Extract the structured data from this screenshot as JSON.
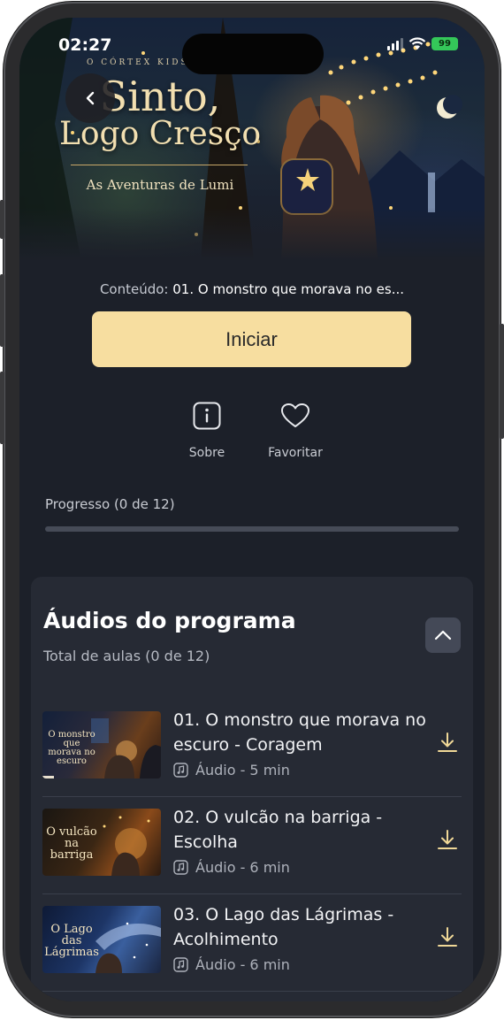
{
  "status_bar": {
    "time": "02:27",
    "battery": "99"
  },
  "hero": {
    "brand": "O CÓRTEX KIDS",
    "title_line1": "Sinto,",
    "title_line2": "Logo Cresço",
    "subtitle": "As Aventuras de Lumi"
  },
  "content": {
    "label": "Conteúdo:",
    "value": "01. O monstro que morava no es..."
  },
  "start_label": "Iniciar",
  "actions": {
    "about": "Sobre",
    "favorite": "Favoritar"
  },
  "progress": {
    "label": "Progresso (0 de 12)",
    "fraction": 0
  },
  "program": {
    "title": "Áudios do programa",
    "subtitle": "Total de aulas (0 de 12)",
    "lessons": [
      {
        "title": "01. O monstro que morava no escuro - Coragem",
        "meta": "Áudio - 5 min",
        "thumb_lines": [
          "O monstro que",
          "morava no escuro"
        ],
        "thumb_progress": 0.1
      },
      {
        "title": "02. O vulcão na barriga - Escolha",
        "meta": "Áudio - 6 min",
        "thumb_lines": [
          "O vulcão",
          "na barriga"
        ],
        "thumb_progress": 0
      },
      {
        "title": "03. O Lago das Lágrimas - Acolhimento",
        "meta": "Áudio - 6 min",
        "thumb_lines": [
          "O Lago",
          "das Lágrimas"
        ],
        "thumb_progress": 0
      }
    ]
  },
  "colors": {
    "accent": "#f7dea0",
    "background": "#1c2029",
    "card": "#262a34"
  }
}
